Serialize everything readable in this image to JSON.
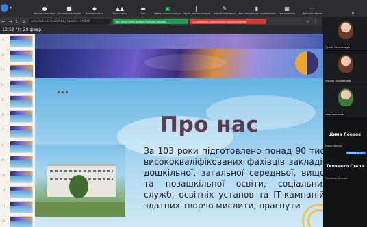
{
  "zoom_toolbar": {
    "items": [
      {
        "label": "Выключить звук",
        "icon": "mic-icon"
      },
      {
        "label": "Остановить видео",
        "icon": "video-icon"
      },
      {
        "label": "Безопасность",
        "icon": "shield-icon"
      },
      {
        "label": "Участники",
        "icon": "participants-icon"
      },
      {
        "label": "Чат",
        "icon": "chat-icon"
      },
      {
        "label": "Новая демонстрация",
        "icon": "share-screen-icon"
      },
      {
        "label": "Пауза демонстрации",
        "icon": "pause-icon"
      },
      {
        "label": "Комментировать",
        "icon": "pen-icon"
      },
      {
        "label": "Дистанционное управление",
        "icon": "remote-control-icon"
      },
      {
        "label": "Приложения",
        "icon": "apps-icon"
      },
      {
        "label": "Дополнительно",
        "icon": "more-icon"
      }
    ]
  },
  "browser": {
    "url": "play.kahoot.it/v2/lobby?quizId=4f42f0",
    "green_banner": "Вы запустили демонстрацию экрана",
    "red_banner": "Остановить совместное использование"
  },
  "status": {
    "time": "13:52",
    "date": "Чт 29 февр."
  },
  "thumbnails": {
    "numbers": [
      "1",
      "2",
      "3",
      "4",
      "5",
      "6",
      "7",
      "8",
      "9",
      "10",
      "11",
      "12",
      "13"
    ]
  },
  "slide": {
    "title": "Про нас",
    "body": "За 103 роки підготовлено понад 90 тис. висококваліфікованих фахівців закладів дошкільної, загальної середньої, вищої та позашкільної освіти, соціальних служб, освітніх установ та ІТ-кампаній, здатних творчо мислити, прагнути"
  },
  "participants": [
    {
      "name": "Тухвін Олександра"
    },
    {
      "name": "Ульяна Кудрявцева"
    },
    {
      "name": "анна маничева"
    }
  ],
  "named_rows": [
    {
      "big": "Дима Леонов",
      "small": "Дима Леонов",
      "tag": "Говорить за..."
    },
    {
      "big": "Ткоченко Степа",
      "small": "Ткоченко Степан"
    }
  ]
}
